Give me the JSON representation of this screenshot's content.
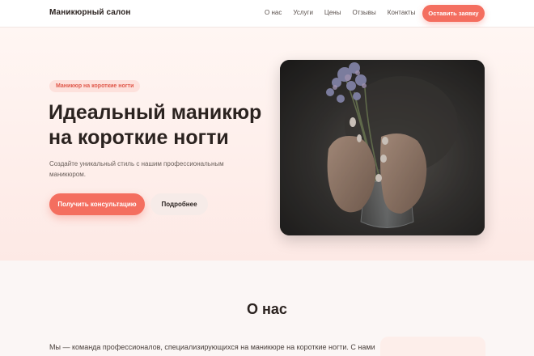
{
  "header": {
    "logo": "Маникюрный салон",
    "nav": [
      "О нас",
      "Услуги",
      "Цены",
      "Отзывы",
      "Контакты"
    ],
    "cta": "Оставить заявку"
  },
  "hero": {
    "badge": "Маникюр на короткие ногти",
    "title_line1": "Идеальный маникюр",
    "title_line2": "на короткие ногти",
    "description": "Создайте уникальный стиль с нашим профессиональным маникюром.",
    "primary_button": "Получить консультацию",
    "secondary_button": "Подробнее"
  },
  "about": {
    "title": "О нас",
    "text": "Мы — команда профессионалов, специализирующихся на маникюре на короткие ногти. С нами"
  },
  "colors": {
    "accent": "#f46e5f",
    "text": "#2b2320"
  }
}
